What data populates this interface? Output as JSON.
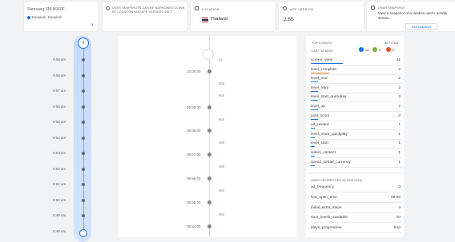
{
  "device": {
    "name": "Samsung SM-N960F",
    "location": "Bangkok, Bangkok"
  },
  "info": {
    "text": "User snapshots can be narrowed down by location and app version only"
  },
  "location_card": {
    "label": "Location",
    "value": "Thailand"
  },
  "version_card": {
    "label": "App version",
    "value": "2.65"
  },
  "snapshot_card": {
    "title": "User snapshot",
    "text": "View a snapshot of a random user's activity stream",
    "button": "Exit snapshot"
  },
  "timeline": {
    "top_count": "0",
    "labels": [
      "9:59 am",
      "9:58 am",
      "9:57 am",
      "9:56 am",
      "9:55 am",
      "9:54 am",
      "9:53 am",
      "9:52 am",
      "9:51 am",
      "9:50 am",
      "9:49 am",
      "9:48 am"
    ]
  },
  "stream": {
    "rows": [
      {
        "time": "",
        "count": "1s"
      },
      {
        "time": "10:00:00",
        "count": ""
      },
      {
        "time": "",
        "count": "60s"
      },
      {
        "time": "",
        "count": "60s"
      },
      {
        "time": "09:59:00",
        "count": ""
      },
      {
        "time": "",
        "count": "60s"
      },
      {
        "time": "09:58:00",
        "count": ""
      },
      {
        "time": "",
        "count": "60s"
      },
      {
        "time": "09:57:00",
        "count": ""
      },
      {
        "time": "",
        "count": "60s"
      },
      {
        "time": "09:56:00",
        "count": ""
      },
      {
        "time": "",
        "count": "60s"
      },
      {
        "time": "09:55:00",
        "count": ""
      },
      {
        "time": "",
        "count": "60s"
      },
      {
        "time": "09:54:00",
        "count": ""
      }
    ]
  },
  "events": {
    "title": "Top events",
    "total": "38 total",
    "subtitle": "Last 30 mins",
    "badges": [
      {
        "num": "28",
        "color": "#1a73e8"
      },
      {
        "num": "0",
        "color": "#7cb342"
      },
      {
        "num": "0",
        "color": "#f4511e"
      }
    ],
    "items": [
      {
        "name": "screen_view",
        "value": "11",
        "color": "#1a73e8",
        "share": 0.35
      },
      {
        "name": "level_complete",
        "value": "2",
        "color": "#e8710a",
        "share": 0.2
      },
      {
        "name": "level_end",
        "value": "2",
        "color": "#1a73e8",
        "share": 0.08
      },
      {
        "name": "level_retry",
        "value": "2",
        "color": "#1a73e8",
        "share": 0.08
      },
      {
        "name": "level_start_quickplay",
        "value": "2",
        "color": "#1a73e8",
        "share": 0.08
      },
      {
        "name": "level_up",
        "value": "2",
        "color": "#1a73e8",
        "share": 0.08
      },
      {
        "name": "post_score",
        "value": "2",
        "color": "#1a73e8",
        "share": 0.08
      },
      {
        "name": "ad_reward",
        "value": "1",
        "color": "#1a73e8",
        "share": 0.04
      },
      {
        "name": "level_reset_quickplay",
        "value": "1",
        "color": "#1a73e8",
        "share": 0.04
      },
      {
        "name": "level_start",
        "value": "1",
        "color": "#1a73e8",
        "share": 0.04
      },
      {
        "name": "select_content",
        "value": "1",
        "color": "#1a73e8",
        "share": 0.04
      },
      {
        "name": "spend_virtual_currency",
        "value": "1",
        "color": "#1a73e8",
        "share": 0.04
      }
    ]
  },
  "properties": {
    "title": "User properties active now",
    "items": [
      {
        "name": "ad_frequency",
        "value": "3"
      },
      {
        "name": "first_open_time",
        "value": "08:00"
      },
      {
        "name": "initial_extra_steps",
        "value": "3"
      },
      {
        "name": "num_levels_available",
        "value": "20"
      },
      {
        "name": "plays_progressive",
        "value": "true"
      }
    ]
  }
}
